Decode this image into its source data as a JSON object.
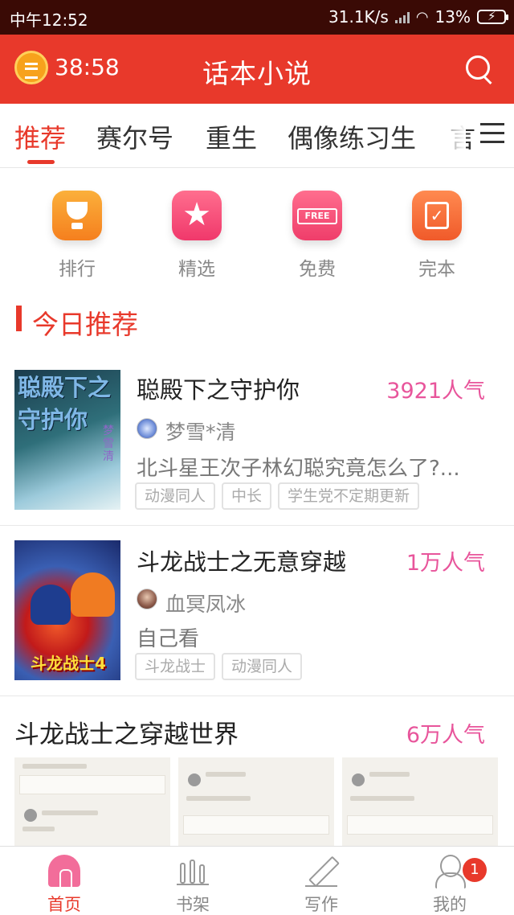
{
  "status_bar": {
    "time": "中午12:52",
    "network_speed": "31.1K/s",
    "battery": "13%"
  },
  "app_bar": {
    "timer": "38:58",
    "title": "话本小说"
  },
  "tabs": [
    {
      "label": "推荐",
      "active": true
    },
    {
      "label": "赛尔号"
    },
    {
      "label": "重生"
    },
    {
      "label": "偶像练习生"
    },
    {
      "label": "言"
    }
  ],
  "quick_links": [
    {
      "label": "排行",
      "icon": "trophy-icon"
    },
    {
      "label": "精选",
      "icon": "star-icon"
    },
    {
      "label": "免费",
      "icon": "free-tag-icon",
      "badge_text": "FREE"
    },
    {
      "label": "完本",
      "icon": "check-book-icon"
    }
  ],
  "section": {
    "title": "今日推荐"
  },
  "books": [
    {
      "title": "聪殿下之守护你",
      "popularity": "3921人气",
      "author": "梦雪*清",
      "description": "北斗星王次子林幻聪究竟怎么了?...",
      "tags": [
        "动漫同人",
        "中长",
        "学生党不定期更新"
      ],
      "cover_text": "聪殿下之守护你",
      "cover_subtext": "梦雪清"
    },
    {
      "title": "斗龙战士之无意穿越",
      "popularity": "1万人气",
      "author": "血冥凤冰",
      "description": "自己看",
      "tags": [
        "斗龙战士",
        "动漫同人"
      ],
      "cover_text": "斗龙战士4"
    },
    {
      "title": "斗龙战士之穿越世界",
      "popularity": "6万人气"
    }
  ],
  "bottom_nav": [
    {
      "label": "首页",
      "icon": "home-icon",
      "active": true
    },
    {
      "label": "书架",
      "icon": "bookshelf-icon"
    },
    {
      "label": "写作",
      "icon": "pen-icon"
    },
    {
      "label": "我的",
      "icon": "profile-icon",
      "badge": "1"
    }
  ],
  "colors": {
    "accent": "#e8392b",
    "popularity": "#e8559b"
  }
}
